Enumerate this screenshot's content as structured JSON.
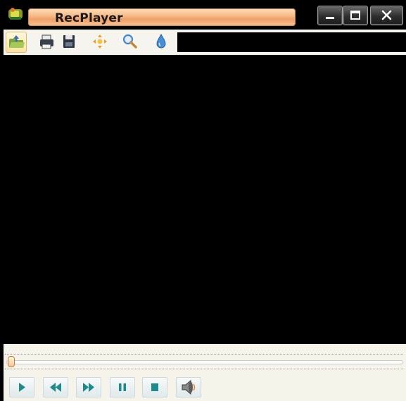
{
  "window": {
    "title": "RecPlayer",
    "controls": [
      "minimize-icon",
      "maximize-icon",
      "close-icon"
    ]
  },
  "toolbar": {
    "buttons": [
      {
        "name": "open-file",
        "icon": "folder-open-icon",
        "active": true
      },
      {
        "name": "print",
        "icon": "printer-icon",
        "active": false
      },
      {
        "name": "save",
        "icon": "floppy-disk-icon",
        "active": false
      },
      {
        "name": "move",
        "icon": "move-arrows-icon",
        "active": false
      },
      {
        "name": "zoom",
        "icon": "magnifier-icon",
        "active": false
      },
      {
        "name": "color",
        "icon": "water-drop-icon",
        "active": false
      }
    ],
    "info_display": ""
  },
  "seek": {
    "position": 0.0
  },
  "controls": [
    {
      "name": "play",
      "icon": "play-icon"
    },
    {
      "name": "rewind",
      "icon": "rewind-icon"
    },
    {
      "name": "fast-forward",
      "icon": "fast-forward-icon"
    },
    {
      "name": "pause",
      "icon": "pause-icon"
    },
    {
      "name": "stop",
      "icon": "stop-icon"
    },
    {
      "name": "volume",
      "icon": "speaker-icon"
    }
  ],
  "colors": {
    "title_pill": "#f6b681",
    "control_glyph": "#1e8a8a",
    "panel_bg": "#f6f3ea",
    "video_bg": "#000000"
  }
}
